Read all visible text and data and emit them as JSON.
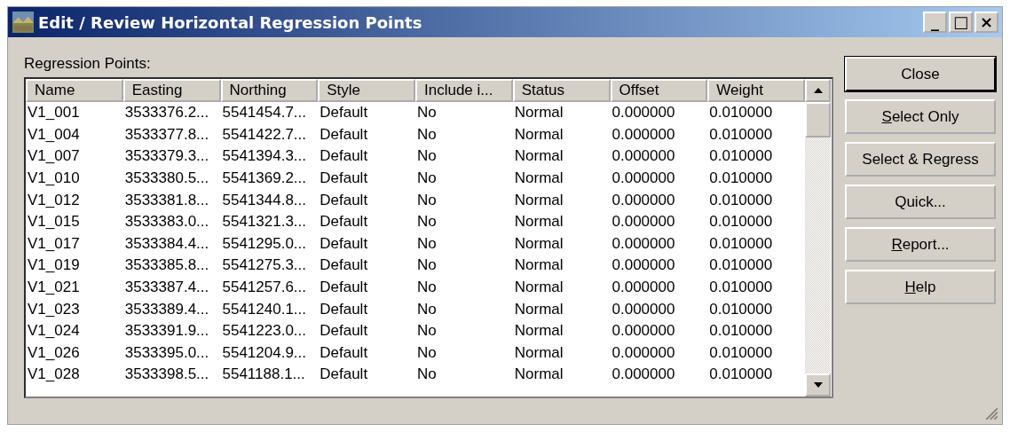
{
  "window": {
    "title": "Edit / Review Horizontal Regression Points",
    "controls": [
      "_",
      "□",
      "×"
    ]
  },
  "list_label": "Regression Points:",
  "table": {
    "columns": [
      "Name",
      "Easting",
      "Northing",
      "Style",
      "Include i...",
      "Status",
      "Offset",
      "Weight"
    ],
    "rows": [
      [
        "V1_001",
        "3533376.2...",
        "5541454.7...",
        "Default",
        "No",
        "Normal",
        "0.000000",
        "0.010000"
      ],
      [
        "V1_004",
        "3533377.8...",
        "5541422.7...",
        "Default",
        "No",
        "Normal",
        "0.000000",
        "0.010000"
      ],
      [
        "V1_007",
        "3533379.3...",
        "5541394.3...",
        "Default",
        "No",
        "Normal",
        "0.000000",
        "0.010000"
      ],
      [
        "V1_010",
        "3533380.5...",
        "5541369.2...",
        "Default",
        "No",
        "Normal",
        "0.000000",
        "0.010000"
      ],
      [
        "V1_012",
        "3533381.8...",
        "5541344.8...",
        "Default",
        "No",
        "Normal",
        "0.000000",
        "0.010000"
      ],
      [
        "V1_015",
        "3533383.0...",
        "5541321.3...",
        "Default",
        "No",
        "Normal",
        "0.000000",
        "0.010000"
      ],
      [
        "V1_017",
        "3533384.4...",
        "5541295.0...",
        "Default",
        "No",
        "Normal",
        "0.000000",
        "0.010000"
      ],
      [
        "V1_019",
        "3533385.8...",
        "5541275.3...",
        "Default",
        "No",
        "Normal",
        "0.000000",
        "0.010000"
      ],
      [
        "V1_021",
        "3533387.4...",
        "5541257.6...",
        "Default",
        "No",
        "Normal",
        "0.000000",
        "0.010000"
      ],
      [
        "V1_023",
        "3533389.4...",
        "5541240.1...",
        "Default",
        "No",
        "Normal",
        "0.000000",
        "0.010000"
      ],
      [
        "V1_024",
        "3533391.9...",
        "5541223.0...",
        "Default",
        "No",
        "Normal",
        "0.000000",
        "0.010000"
      ],
      [
        "V1_026",
        "3533395.0...",
        "5541204.9...",
        "Default",
        "No",
        "Normal",
        "0.000000",
        "0.010000"
      ],
      [
        "V1_028",
        "3533398.5...",
        "5541188.1...",
        "Default",
        "No",
        "Normal",
        "0.000000",
        "0.010000"
      ]
    ]
  },
  "buttons": [
    {
      "label": "Close",
      "default": true,
      "underline_first": false
    },
    {
      "label": "Select Only",
      "default": false,
      "underline_first": true
    },
    {
      "label": "Select & Regress",
      "default": false,
      "underline_first": false
    },
    {
      "label": "Quick...",
      "default": false,
      "underline_first": false
    },
    {
      "label": "Report...",
      "default": false,
      "underline_first": true
    },
    {
      "label": "Help",
      "default": false,
      "underline_first": true
    }
  ]
}
